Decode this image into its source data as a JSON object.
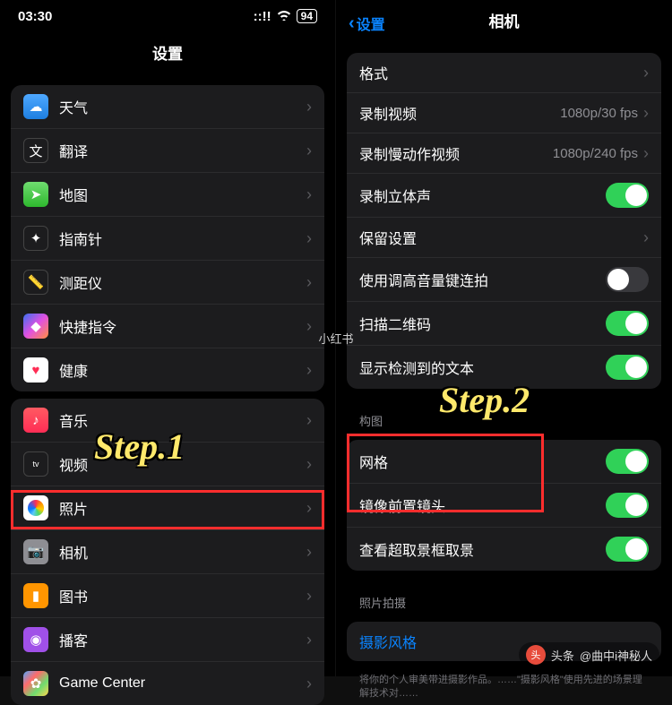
{
  "status": {
    "time": "03:30",
    "signal": "::!!",
    "wifi": "􀙇",
    "battery": "94"
  },
  "left": {
    "title": "设置",
    "group1": [
      {
        "label": "天气"
      },
      {
        "label": "翻译"
      },
      {
        "label": "地图"
      },
      {
        "label": "指南针"
      },
      {
        "label": "测距仪"
      },
      {
        "label": "快捷指令"
      },
      {
        "label": "健康"
      }
    ],
    "group2": [
      {
        "label": "音乐"
      },
      {
        "label": "视频"
      },
      {
        "label": "照片"
      },
      {
        "label": "相机"
      },
      {
        "label": "图书"
      },
      {
        "label": "播客"
      },
      {
        "label": "Game Center"
      }
    ]
  },
  "right": {
    "back": "设置",
    "title": "相机",
    "group1": [
      {
        "label": "格式",
        "type": "link"
      },
      {
        "label": "录制视频",
        "value": "1080p/30 fps",
        "type": "link"
      },
      {
        "label": "录制慢动作视频",
        "value": "1080p/240 fps",
        "type": "link"
      },
      {
        "label": "录制立体声",
        "type": "toggle",
        "on": true
      },
      {
        "label": "保留设置",
        "type": "link"
      },
      {
        "label": "使用调高音量键连拍",
        "type": "toggle",
        "on": false
      },
      {
        "label": "扫描二维码",
        "type": "toggle",
        "on": true
      },
      {
        "label": "显示检测到的文本",
        "type": "toggle",
        "on": true
      }
    ],
    "sec2_header": "构图",
    "group2": [
      {
        "label": "网格",
        "type": "toggle",
        "on": true
      },
      {
        "label": "镜像前置镜头",
        "type": "toggle",
        "on": true
      },
      {
        "label": "查看超取景框取景",
        "type": "toggle",
        "on": true
      }
    ],
    "sec3_header": "照片拍摄",
    "group3_link": "摄影风格",
    "footer": "将你的个人审美带进摄影作品。……\"摄影风格\"使用先进的场景理解技术对……"
  },
  "annotations": {
    "step1": "Step.1",
    "step2": "Step.2",
    "watermark": "小红书",
    "source_prefix": "头条",
    "source_name": "@曲中i神秘人"
  }
}
